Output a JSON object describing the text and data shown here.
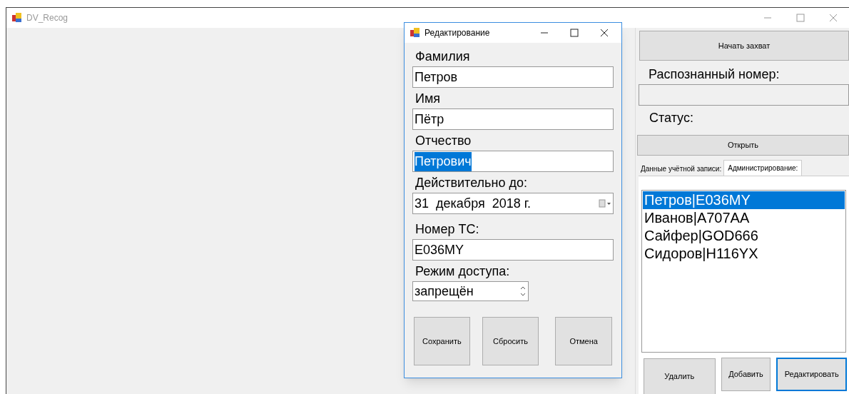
{
  "main_window": {
    "title": "DV_Recog"
  },
  "dialog": {
    "title": "Редактирование",
    "fields": [
      {
        "kind": "text",
        "label": "Фамилия",
        "value": "Петров",
        "text_selected": false
      },
      {
        "kind": "text",
        "label": "Имя",
        "value": "Пётр",
        "text_selected": false
      },
      {
        "kind": "text",
        "label": "Отчество",
        "value": "Петрович",
        "text_selected": true
      },
      {
        "kind": "date",
        "label": "Действительно до:",
        "value": "31  декабря  2018 г."
      },
      {
        "kind": "text",
        "label": "Номер ТС:",
        "value": "E036MY",
        "text_selected": false
      },
      {
        "kind": "spin",
        "label": "Режим доступа:",
        "value": "запрещён"
      }
    ],
    "buttons": [
      "Сохранить",
      "Сбросить",
      "Отмена"
    ]
  },
  "panel": {
    "capture_button": "Начать захват",
    "recognized_label": "Распознанный номер:",
    "status_label": "Статус:",
    "open_button": "Открыть",
    "tabs": [
      {
        "label": "Данные учётной записи:",
        "selected": false
      },
      {
        "label": "Администрирование:",
        "selected": true
      }
    ],
    "list_items": [
      {
        "text": "Петров|E036MY",
        "selected": true
      },
      {
        "text": "Иванов|A707AA",
        "selected": false
      },
      {
        "text": "Сайфер|GOD666",
        "selected": false
      },
      {
        "text": "Сидоров|H116YX",
        "selected": false
      }
    ],
    "buttons": [
      {
        "label": "Удалить",
        "focused": false
      },
      {
        "label": "Добавить",
        "focused": false
      },
      {
        "label": "Редактировать",
        "focused": true
      }
    ]
  }
}
